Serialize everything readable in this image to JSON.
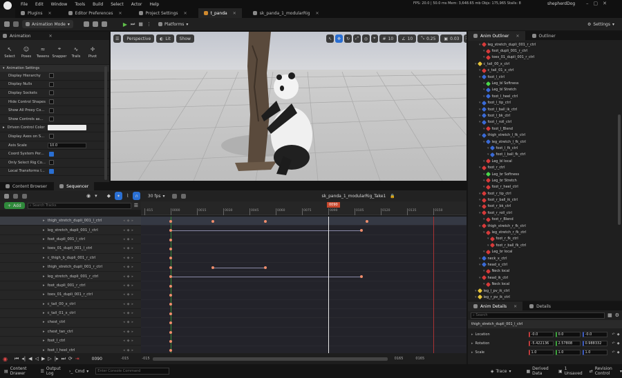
{
  "menu": {
    "items": [
      "File",
      "Edit",
      "Window",
      "Tools",
      "Build",
      "Select",
      "Actor",
      "Help"
    ]
  },
  "titlebar": {
    "tabs": [
      "Plugins",
      "Editor Preferences",
      "Project Settings",
      "t_panda",
      "sk_panda_1_modularRig"
    ],
    "stats": "FPS: 20.0  |  50.0 ms  Mem: 3,648.65 mb  Objs: 175,965  Stalls: 8",
    "project": "shepherdDog"
  },
  "toolbar": {
    "mode": "Animation Mode",
    "platforms": "Platforms",
    "settings": "Settings"
  },
  "animation": {
    "title": "Animation",
    "tools": [
      "Select",
      "Poses",
      "Tweens",
      "Snapper",
      "Trails",
      "Pivot"
    ],
    "settings_header": "Animation Settings",
    "rows": [
      {
        "label": "Display Hierarchy",
        "on": false
      },
      {
        "label": "Display Nulls",
        "on": false
      },
      {
        "label": "Display Sockets",
        "on": false
      },
      {
        "label": "Hide Control Shapes",
        "on": false
      },
      {
        "label": "Show All Proxy Co...",
        "on": false
      },
      {
        "label": "Show Controls as...",
        "on": false
      },
      {
        "label": "Driven Control Color",
        "color": true
      },
      {
        "label": "Display Axes on S...",
        "on": false
      },
      {
        "label": "Axis Scale",
        "value": "10.0"
      },
      {
        "label": "Coord System Per...",
        "on": true
      },
      {
        "label": "Only Select Rig Co...",
        "on": false
      },
      {
        "label": "Local Transforms I...",
        "on": true
      }
    ]
  },
  "viewport": {
    "perspective": "Perspective",
    "lit": "Lit",
    "show": "Show",
    "grid": "10",
    "angle": "10",
    "scale": "0.25",
    "speed": "0.03"
  },
  "sequencer": {
    "tabs": [
      "Content Browser",
      "Sequencer"
    ],
    "fps": "30 fps",
    "title": "sk_panda_1_modularRig_Take1",
    "add": "Add",
    "search_placeholder": "Search Tracks",
    "ruler": [
      "-015",
      "0000",
      "0015",
      "0030",
      "0045",
      "0060",
      "0075",
      "0090",
      "0105",
      "0120",
      "0135",
      "0150"
    ],
    "playhead": "0090",
    "tracks": [
      "thigh_stretch_dupli_001_l_ctrl",
      "leg_stretch_dupli_001_l_ctrl",
      "foot_dupli_001_l_ctrl",
      "toes_01_dupli_001_l_ctrl",
      "c_thigh_b_dupli_001_r_ctrl",
      "thigh_stretch_dupli_001_r_ctrl",
      "leg_stretch_dupli_001_r_ctrl",
      "foot_dupli_001_r_ctrl",
      "toes_01_dupli_001_r_ctrl",
      "c_tail_00_x_ctrl",
      "c_tail_01_x_ctrl",
      "chest_ctrl",
      "chest_tan_ctrl",
      "foot_l_ctrl",
      "foot_l_heel_ctrl"
    ],
    "transport": {
      "frame": "0090",
      "start": "-015",
      "start2": "-015",
      "end": "0165",
      "end2": "0165"
    }
  },
  "outliner": {
    "tabs": [
      "Anim Outliner",
      "Outliner"
    ],
    "items": [
      {
        "t": "leg_stretch_dupli_001_r_ctrl",
        "c": "#d63a3a"
      },
      {
        "t": "foot_dupli_001_r_ctrl",
        "c": "#d63a3a"
      },
      {
        "t": "toes_01_dupli_001_r_ctrl",
        "c": "#d63a3a"
      },
      {
        "t": "c_tail_00_x_ctrl",
        "c": "#e6c43a"
      },
      {
        "t": "c_tail_01_x_ctrl",
        "c": "#d63a3a"
      },
      {
        "t": "foot_l_ctrl",
        "c": "#3a6ad6"
      },
      {
        "t": "Leg_bl Softness",
        "c": "#4ad64a"
      },
      {
        "t": "Leg_bl Stretch",
        "c": "#3a6ad6"
      },
      {
        "t": "foot_l_heel_ctrl",
        "c": "#3a6ad6"
      },
      {
        "t": "foot_l_tip_ctrl",
        "c": "#3a6ad6"
      },
      {
        "t": "foot_l_ball_ik_ctrl",
        "c": "#3a6ad6"
      },
      {
        "t": "foot_l_bk_ctrl",
        "c": "#3a6ad6"
      },
      {
        "t": "foot_l_roll_ctrl",
        "c": "#3a6ad6"
      },
      {
        "t": "foot_l_Blend",
        "c": "#d63a3a"
      },
      {
        "t": "thigh_stretch_l_fk_ctrl",
        "c": "#3a6ad6"
      },
      {
        "t": "leg_stretch_l_fk_ctrl",
        "c": "#3a6ad6"
      },
      {
        "t": "foot_l_fk_ctrl",
        "c": "#3a6ad6"
      },
      {
        "t": "foot_l_ball_fk_ctrl",
        "c": "#3a6ad6"
      },
      {
        "t": "Leg_bl local",
        "c": "#d63a3a"
      },
      {
        "t": "foot_r_ctrl",
        "c": "#d63a3a"
      },
      {
        "t": "Leg_br Softness",
        "c": "#4ad64a"
      },
      {
        "t": "Leg_br Stretch",
        "c": "#d63a3a"
      },
      {
        "t": "foot_r_heel_ctrl",
        "c": "#d63a3a"
      },
      {
        "t": "foot_r_tip_ctrl",
        "c": "#d63a3a"
      },
      {
        "t": "foot_r_ball_ik_ctrl",
        "c": "#d63a3a"
      },
      {
        "t": "foot_r_bk_ctrl",
        "c": "#d63a3a"
      },
      {
        "t": "foot_r_roll_ctrl",
        "c": "#d63a3a"
      },
      {
        "t": "foot_r_Blend",
        "c": "#d63a3a"
      },
      {
        "t": "thigh_stretch_r_fk_ctrl",
        "c": "#d63a3a"
      },
      {
        "t": "leg_stretch_r_fk_ctrl",
        "c": "#d63a3a"
      },
      {
        "t": "foot_r_fk_ctrl",
        "c": "#d63a3a"
      },
      {
        "t": "foot_r_ball_fk_ctrl",
        "c": "#d63a3a"
      },
      {
        "t": "Leg_br local",
        "c": "#d63a3a"
      },
      {
        "t": "neck_x_ctrl",
        "c": "#3a6ad6"
      },
      {
        "t": "head_x_ctrl",
        "c": "#3a6ad6"
      },
      {
        "t": "Neck local",
        "c": "#d63a3a"
      },
      {
        "t": "head_ik_ctrl",
        "c": "#d63a3a"
      },
      {
        "t": "Neck local",
        "c": "#d63a3a"
      },
      {
        "t": "leg_l_pv_ik_ctrl",
        "c": "#e6c43a"
      },
      {
        "t": "leg_r_pv_ik_ctrl",
        "c": "#e6c43a"
      }
    ]
  },
  "details": {
    "tabs": [
      "Anim Details",
      "Details"
    ],
    "search_placeholder": "Search",
    "object": "thigh_stretch_dupli_001_l_ctrl",
    "rows": [
      {
        "label": "Location",
        "v": [
          "-0.0",
          "0.0",
          "-0.0"
        ]
      },
      {
        "label": "Rotation",
        "v": [
          "-5.422136",
          "2.57808",
          "0.988332"
        ]
      },
      {
        "label": "Scale",
        "v": [
          "1.0",
          "1.0",
          "1.0"
        ]
      }
    ]
  },
  "statusbar": {
    "content_drawer": "Content Drawer",
    "output_log": "Output Log",
    "cmd": "Cmd",
    "console_placeholder": "Enter Console Command",
    "trace": "Trace",
    "derived": "Derived Data",
    "unsaved": "1 Unsaved",
    "revision": "Revision Control"
  }
}
